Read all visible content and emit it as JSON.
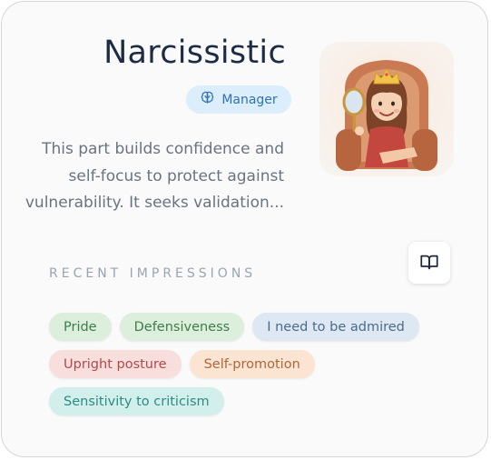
{
  "part": {
    "title": "Narcissistic",
    "role": "Manager",
    "description": "This part builds confidence and self-focus to protect against vulnerability. It seeks validation..."
  },
  "impressions": {
    "label": "RECENT IMPRESSIONS",
    "tags": [
      {
        "label": "Pride",
        "color": "green"
      },
      {
        "label": "Defensiveness",
        "color": "green"
      },
      {
        "label": "I need to be admired",
        "color": "blue"
      },
      {
        "label": "Upright posture",
        "color": "red"
      },
      {
        "label": "Self-promotion",
        "color": "orange"
      },
      {
        "label": "Sensitivity to criticism",
        "color": "teal"
      }
    ]
  },
  "icons": {
    "role_icon": "brain-icon",
    "journal_icon": "book-open-icon"
  },
  "colors": {
    "title": "#1d2b45",
    "badge_bg": "#dceefb",
    "badge_text": "#2f73b4"
  }
}
